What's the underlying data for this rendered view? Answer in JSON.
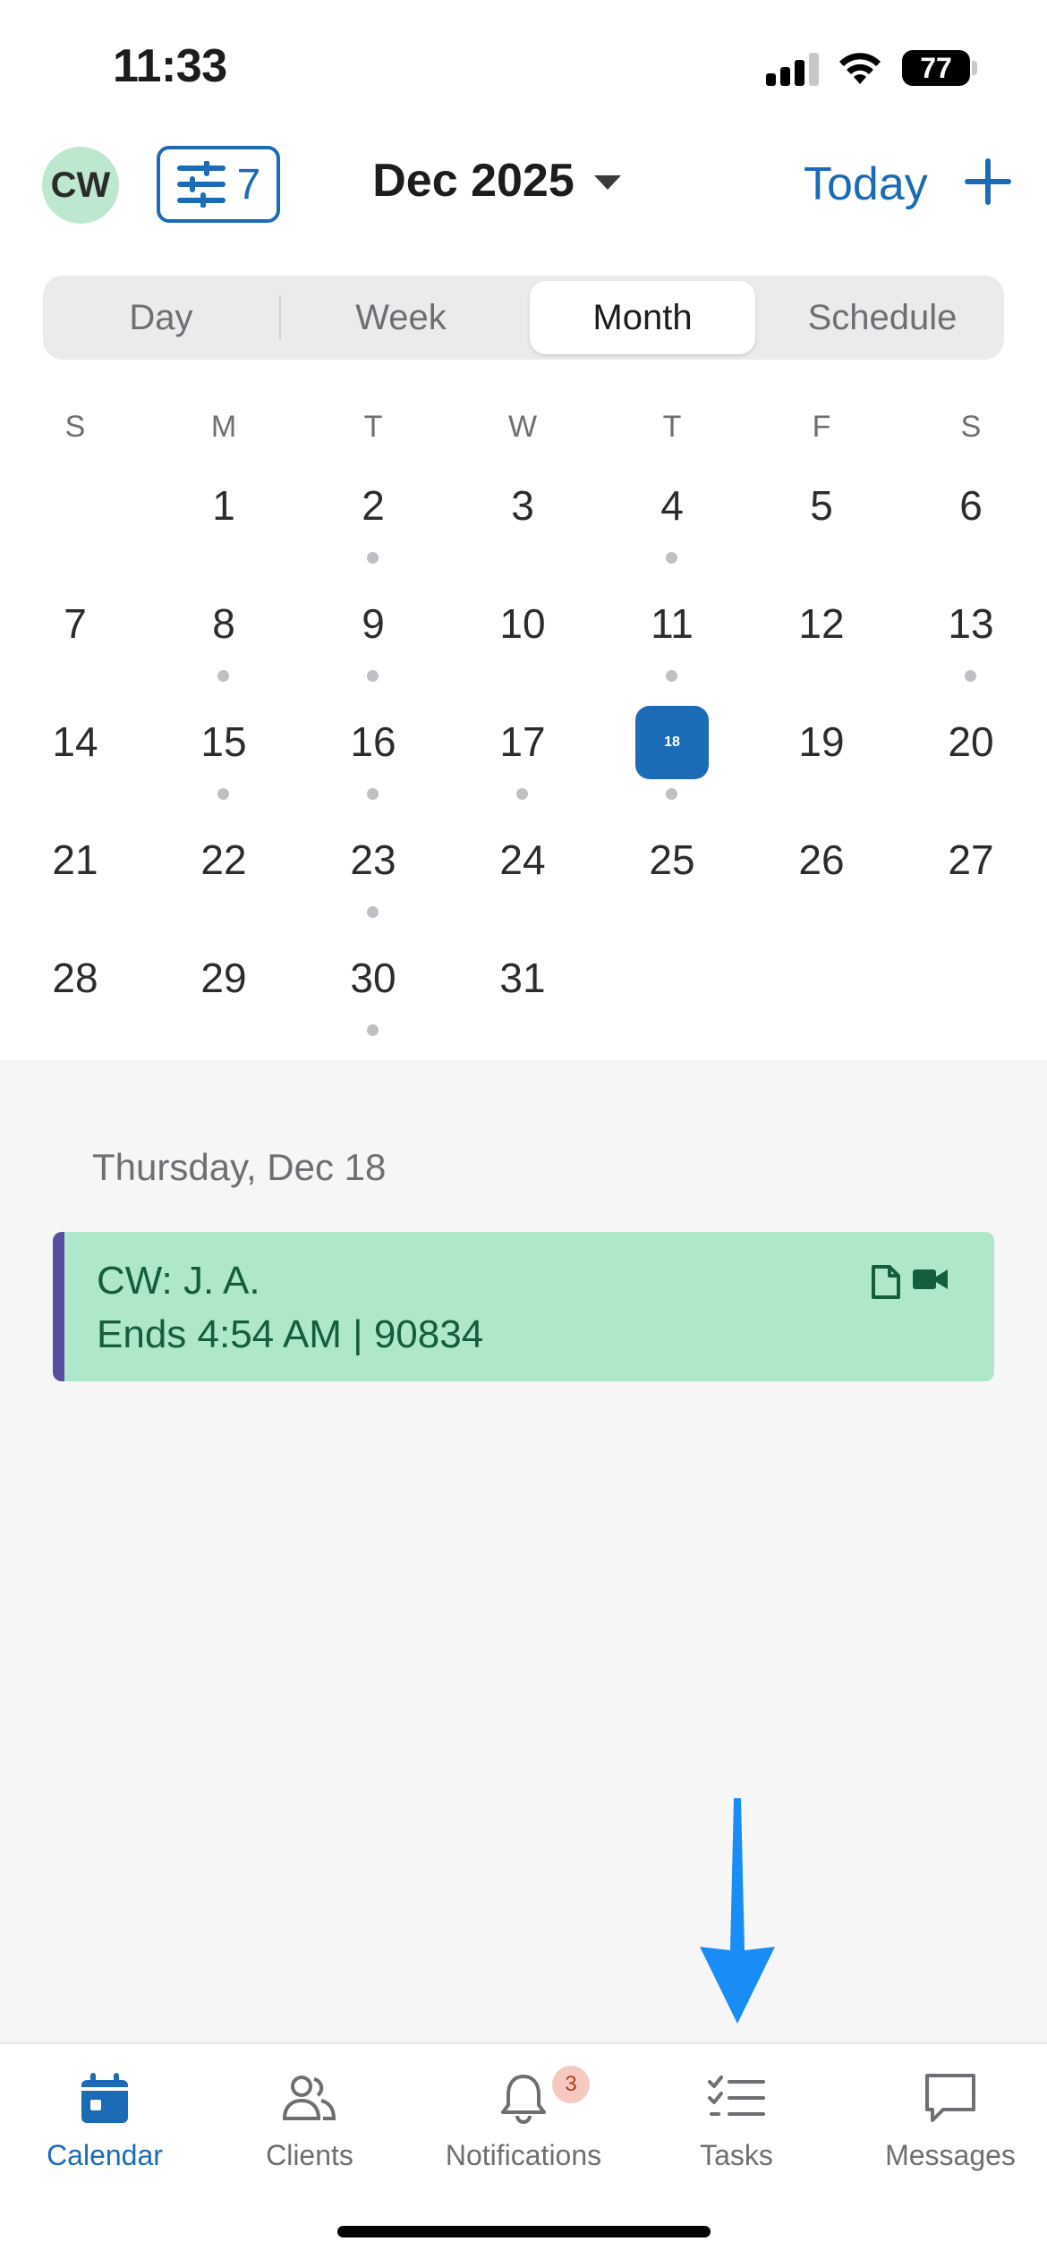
{
  "status_bar": {
    "time": "11:33",
    "battery": "77"
  },
  "header": {
    "avatar_initials": "CW",
    "filter_count": "7",
    "month_title": "Dec 2025",
    "today_label": "Today"
  },
  "view_tabs": [
    "Day",
    "Week",
    "Month",
    "Schedule"
  ],
  "active_view": "Month",
  "calendar": {
    "weekdays": [
      "S",
      "M",
      "T",
      "W",
      "T",
      "F",
      "S"
    ],
    "weeks": [
      [
        "",
        "1",
        "2",
        "3",
        "4",
        "5",
        "6"
      ],
      [
        "7",
        "8",
        "9",
        "10",
        "11",
        "12",
        "13"
      ],
      [
        "14",
        "15",
        "16",
        "17",
        "18",
        "19",
        "20"
      ],
      [
        "21",
        "22",
        "23",
        "24",
        "25",
        "26",
        "27"
      ],
      [
        "28",
        "29",
        "30",
        "31",
        "",
        "",
        ""
      ]
    ],
    "selected_day": "18",
    "days_with_events": [
      "2",
      "4",
      "8",
      "9",
      "11",
      "13",
      "15",
      "16",
      "17",
      "18",
      "23",
      "30"
    ]
  },
  "agenda": {
    "date_heading": "Thursday, Dec 18",
    "event": {
      "title": "CW: J. A.",
      "subtitle": "Ends 4:54 AM  |  90834",
      "color": "#aee8c9",
      "stripe_color": "#5a4ea2"
    }
  },
  "tab_bar": {
    "items": [
      {
        "label": "Calendar",
        "icon": "calendar-icon"
      },
      {
        "label": "Clients",
        "icon": "clients-icon"
      },
      {
        "label": "Notifications",
        "icon": "bell-icon"
      },
      {
        "label": "Tasks",
        "icon": "tasks-icon"
      },
      {
        "label": "Messages",
        "icon": "message-icon"
      }
    ],
    "active": "Calendar",
    "notifications_badge": "3"
  },
  "colors": {
    "accent": "#1c6bb6",
    "arrow": "#1a8cf5"
  }
}
